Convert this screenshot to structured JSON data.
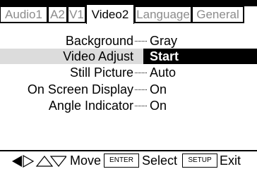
{
  "tabs": [
    {
      "label": "Audio1",
      "active": false
    },
    {
      "label": "A2",
      "active": false
    },
    {
      "label": "V1",
      "active": false
    },
    {
      "label": "Video2",
      "active": true
    },
    {
      "label": "Language",
      "active": false
    },
    {
      "label": "General",
      "active": false
    }
  ],
  "menu": {
    "items": [
      {
        "label": "Background",
        "value": "Gray"
      },
      {
        "label": "Video Adjust",
        "value": "Start"
      },
      {
        "label": "Still Picture",
        "value": "Auto"
      },
      {
        "label": "On Screen Display",
        "value": "On"
      },
      {
        "label": "Angle Indicator",
        "value": "On"
      }
    ]
  },
  "footer": {
    "move_label": "Move",
    "enter_key": "ENTER",
    "select_label": "Select",
    "setup_key": "SETUP",
    "exit_label": "Exit"
  },
  "colors": {
    "highlight": "#dcdcdc",
    "selected": "#000000",
    "inactive_tab_text": "#8c8c8c"
  }
}
